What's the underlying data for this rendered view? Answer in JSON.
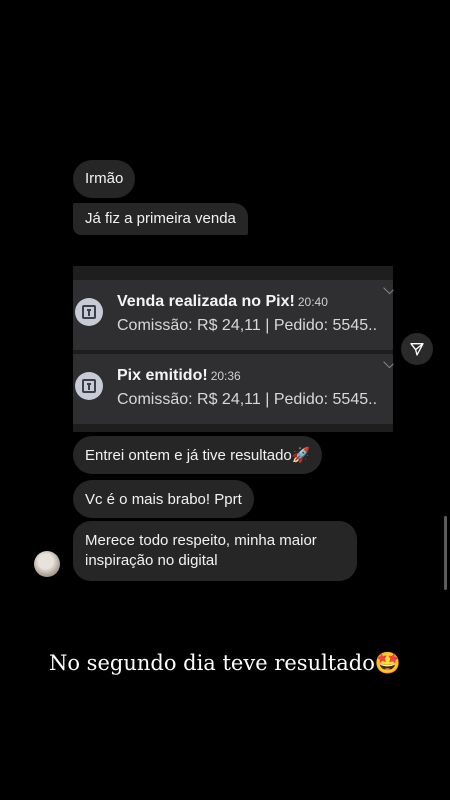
{
  "messages": {
    "irmao": "Irmão",
    "primeira_venda": "Já fiz a primeira venda",
    "entrei": "Entrei ontem e já tive resultado🚀",
    "mais_brabo": "Vc é o mais brabo! Pprt",
    "merece": "Merece todo respeito, minha maior inspiração no digital"
  },
  "notifications": [
    {
      "title": "Venda realizada no Pix!",
      "time": "20:40",
      "body": "Comissão: R$ 24,11 | Pedido: 5545..",
      "icon": "t-app-icon"
    },
    {
      "title": "Pix emitido!",
      "time": "20:36",
      "body": "Comissão: R$ 24,11 | Pedido: 5545..",
      "icon": "t-app-icon"
    }
  ],
  "caption": "No segundo dia teve resultado🤩",
  "icons": {
    "share": "send-icon",
    "avatar": "avatar"
  },
  "colors": {
    "background": "#000000",
    "bubble": "#262626",
    "notification": "#2f2f31"
  }
}
